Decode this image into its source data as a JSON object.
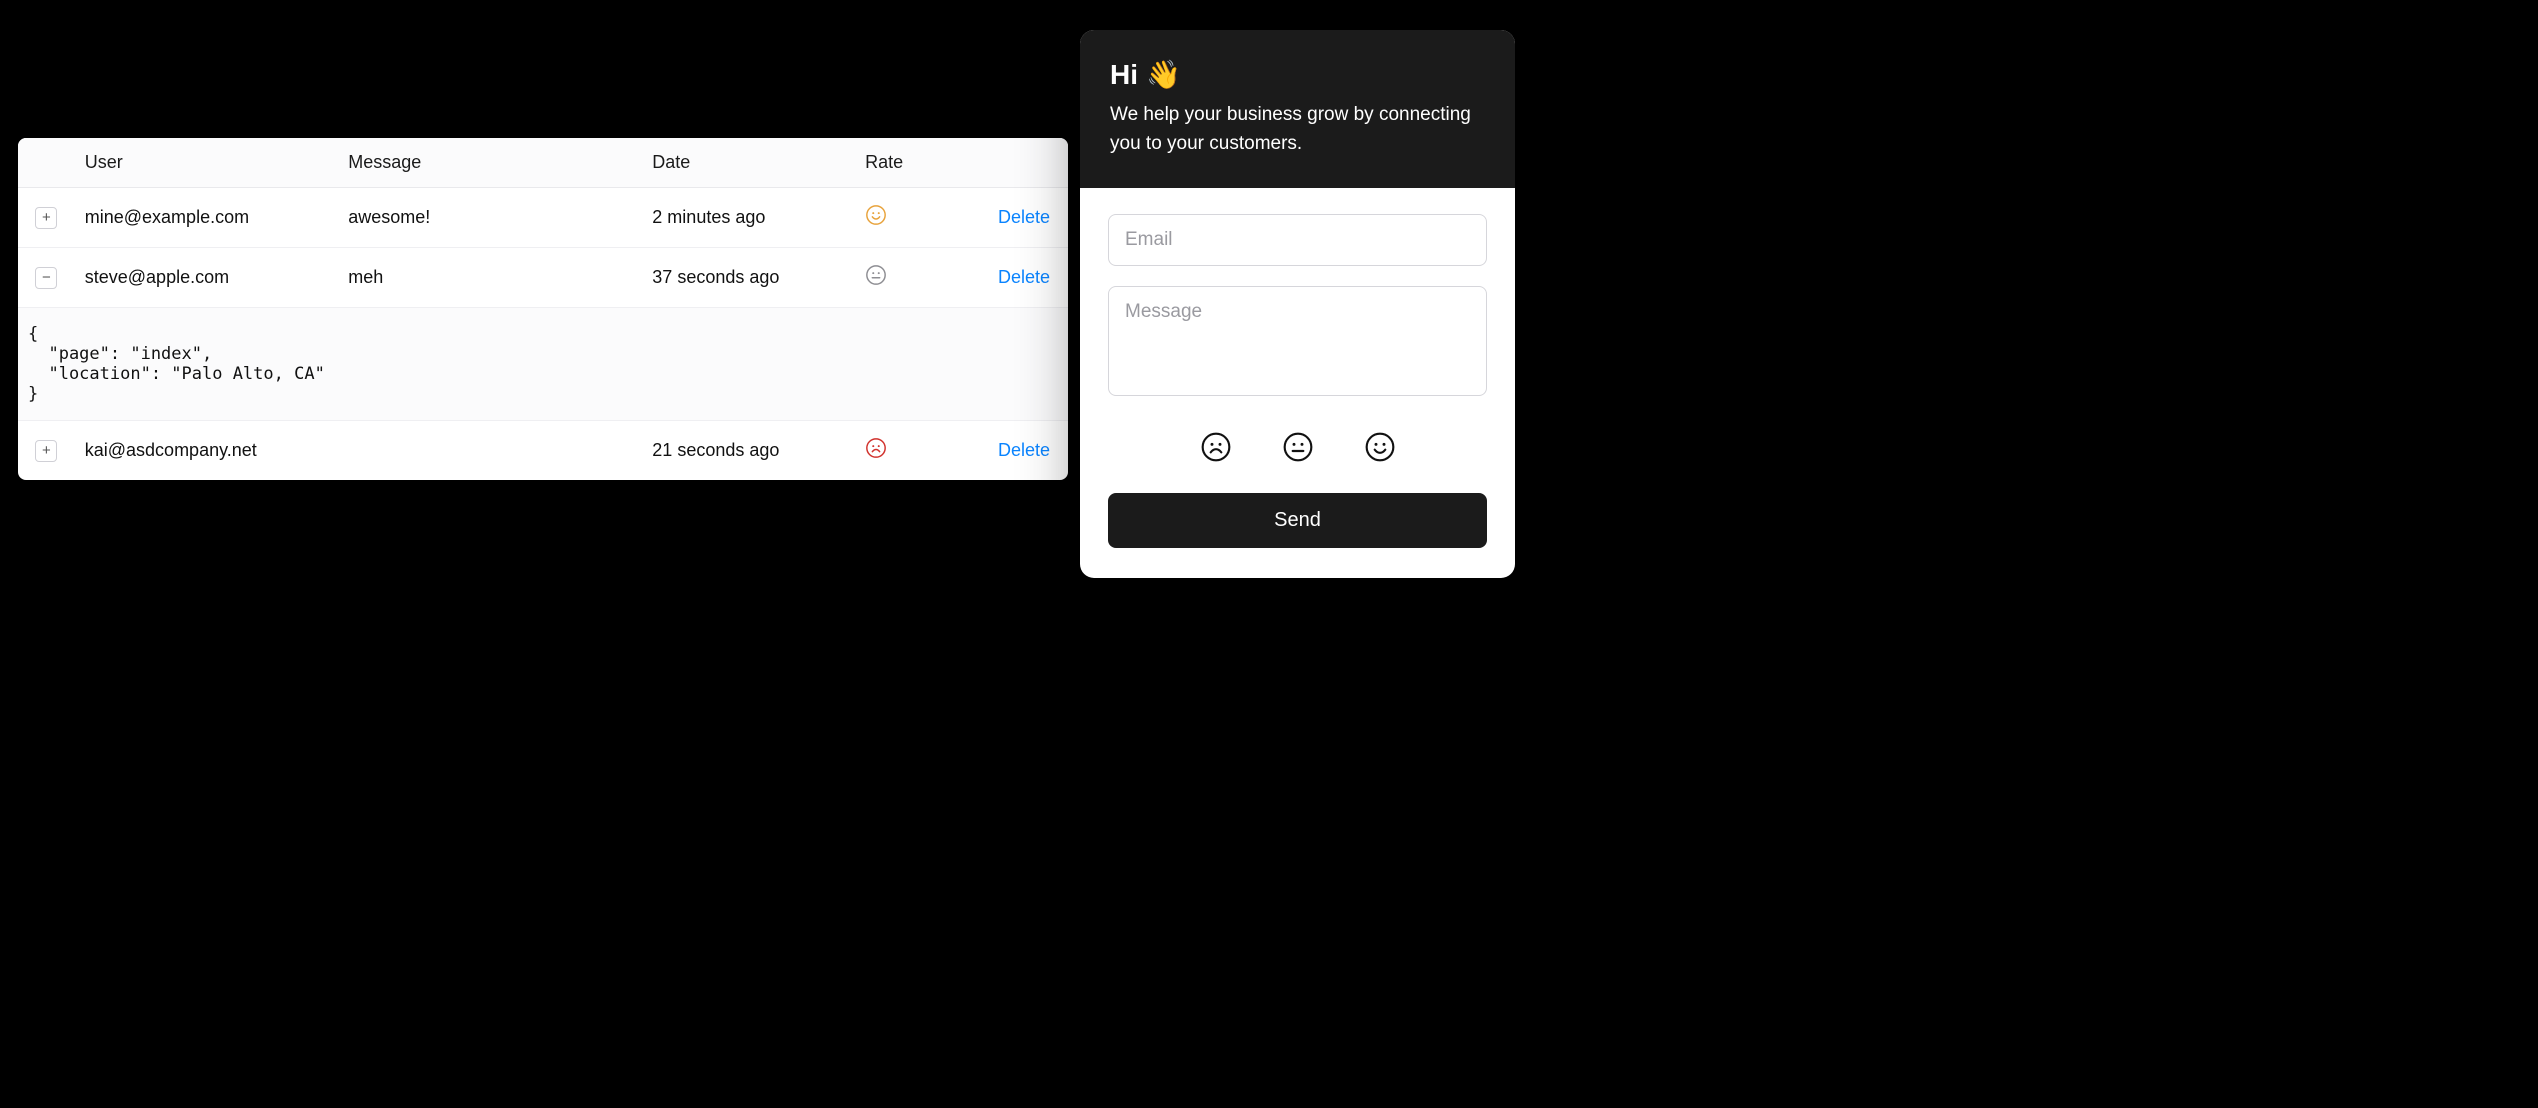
{
  "table": {
    "headers": {
      "user": "User",
      "message": "Message",
      "date": "Date",
      "rate": "Rate"
    },
    "delete_label": "Delete",
    "rows": [
      {
        "expanded": false,
        "user": "mine@example.com",
        "message": "awesome!",
        "date": "2 minutes ago",
        "rate": "smile",
        "rate_color": "#e8a33c"
      },
      {
        "expanded": true,
        "user": "steve@apple.com",
        "message": "meh",
        "date": "37 seconds ago",
        "rate": "meh",
        "rate_color": "#8e8e93",
        "detail": "{\n  \"page\": \"index\",\n  \"location\": \"Palo Alto, CA\"\n}"
      },
      {
        "expanded": false,
        "user": "kai@asdcompany.net",
        "message": "",
        "date": "21 seconds ago",
        "rate": "frown",
        "rate_color": "#d1322d"
      }
    ]
  },
  "widget": {
    "title": "Hi",
    "title_emoji": "👋",
    "subtitle": "We help your business grow by connecting you to your customers.",
    "email_placeholder": "Email",
    "message_placeholder": "Message",
    "send_label": "Send",
    "ratings": [
      "frown",
      "meh",
      "smile"
    ]
  }
}
